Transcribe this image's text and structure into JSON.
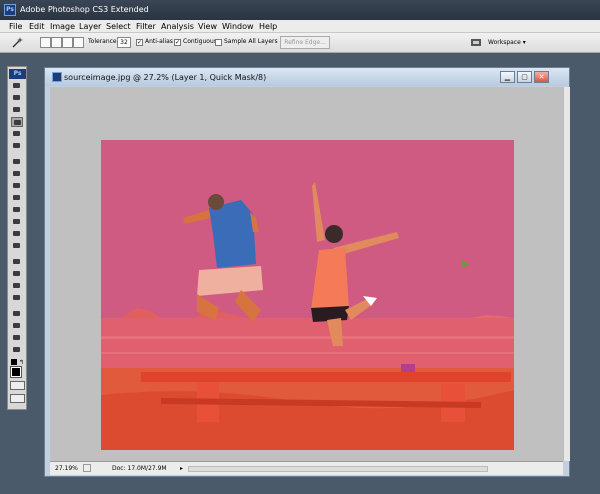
{
  "app": {
    "title": "Adobe Photoshop CS3 Extended"
  },
  "menu": {
    "items": [
      "File",
      "Edit",
      "Image",
      "Layer",
      "Select",
      "Filter",
      "Analysis",
      "View",
      "Window",
      "Help"
    ]
  },
  "options": {
    "tolerance_label": "Tolerance:",
    "tolerance_value": "32",
    "anti_alias_label": "Anti-alias",
    "anti_alias_checked": true,
    "contiguous_label": "Contiguous",
    "contiguous_checked": true,
    "sample_all_layers_label": "Sample All Layers",
    "sample_all_layers_checked": false,
    "refine_edge_label": "Refine Edge...",
    "workspace_label": "Workspace"
  },
  "toolbox": {
    "logo": "Ps",
    "active_tool": "magic-wand-tool",
    "foreground_color": "#000000",
    "background_color": "#ffffff"
  },
  "document": {
    "title": "sourceimage.jpg @ 27.2% (Layer 1, Quick Mask/8)",
    "zoom": "27.19%",
    "doc_size": "Doc: 17.0M/27.9M",
    "quick_mask_color": "#e0245a"
  },
  "colors": {
    "title_bar": "#2e3a4a",
    "menu_bar": "#ececec",
    "workspace_bg": "#c0c0c0"
  }
}
